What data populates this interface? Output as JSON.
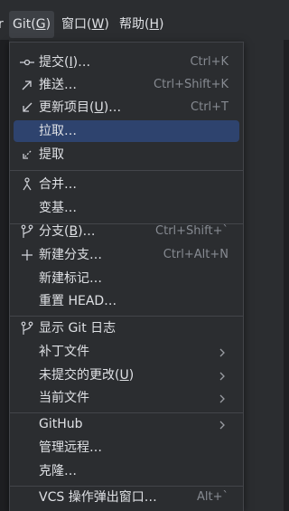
{
  "menubar": {
    "partial_left": "r",
    "git": {
      "text": "Git(",
      "mnemonic": "G",
      "close": ")"
    },
    "window": {
      "text": "窗口(",
      "mnemonic": "W",
      "close": ")"
    },
    "help": {
      "text": "帮助(",
      "mnemonic": "H",
      "close": ")"
    }
  },
  "menu": {
    "commit": {
      "label_pre": "提交(",
      "mnemonic": "I",
      "label_post": ")…",
      "shortcut": "Ctrl+K",
      "icon": "commit-icon"
    },
    "push": {
      "label": "推送…",
      "shortcut": "Ctrl+Shift+K",
      "icon": "push-arrow-icon"
    },
    "update": {
      "label_pre": "更新项目(",
      "mnemonic": "U",
      "label_post": ")…",
      "shortcut": "Ctrl+T",
      "icon": "update-arrow-icon"
    },
    "pull": {
      "label": "拉取…"
    },
    "fetch": {
      "label": "提取",
      "icon": "fetch-icon"
    },
    "merge": {
      "label": "合并…",
      "icon": "merge-icon"
    },
    "rebase": {
      "label": "变基…"
    },
    "branches": {
      "label_pre": "分支(",
      "mnemonic": "B",
      "label_post": ")…",
      "shortcut": "Ctrl+Shift+`",
      "icon": "branch-icon"
    },
    "new_branch": {
      "label": "新建分支…",
      "shortcut": "Ctrl+Alt+N",
      "icon": "plus-icon"
    },
    "new_tag": {
      "label": "新建标记…"
    },
    "reset_head": {
      "label": "重置 HEAD…"
    },
    "show_log": {
      "label": "显示 Git 日志",
      "icon": "branch-icon"
    },
    "patch": {
      "label": "补丁文件"
    },
    "uncommitted": {
      "label_pre": "未提交的更改(",
      "mnemonic": "U",
      "label_post": ")"
    },
    "current_file": {
      "label": "当前文件"
    },
    "github": {
      "label": "GitHub"
    },
    "manage_remotes": {
      "label": "管理远程…"
    },
    "clone": {
      "label": "克隆…"
    },
    "vcs_popup": {
      "label": "VCS 操作弹出窗口…",
      "shortcut": "Alt+`"
    }
  },
  "colors": {
    "background": "#2b2d30",
    "selection": "#2e436e",
    "text": "#dfe1e5",
    "shortcut_text": "#868a91",
    "separator": "#43454a"
  }
}
